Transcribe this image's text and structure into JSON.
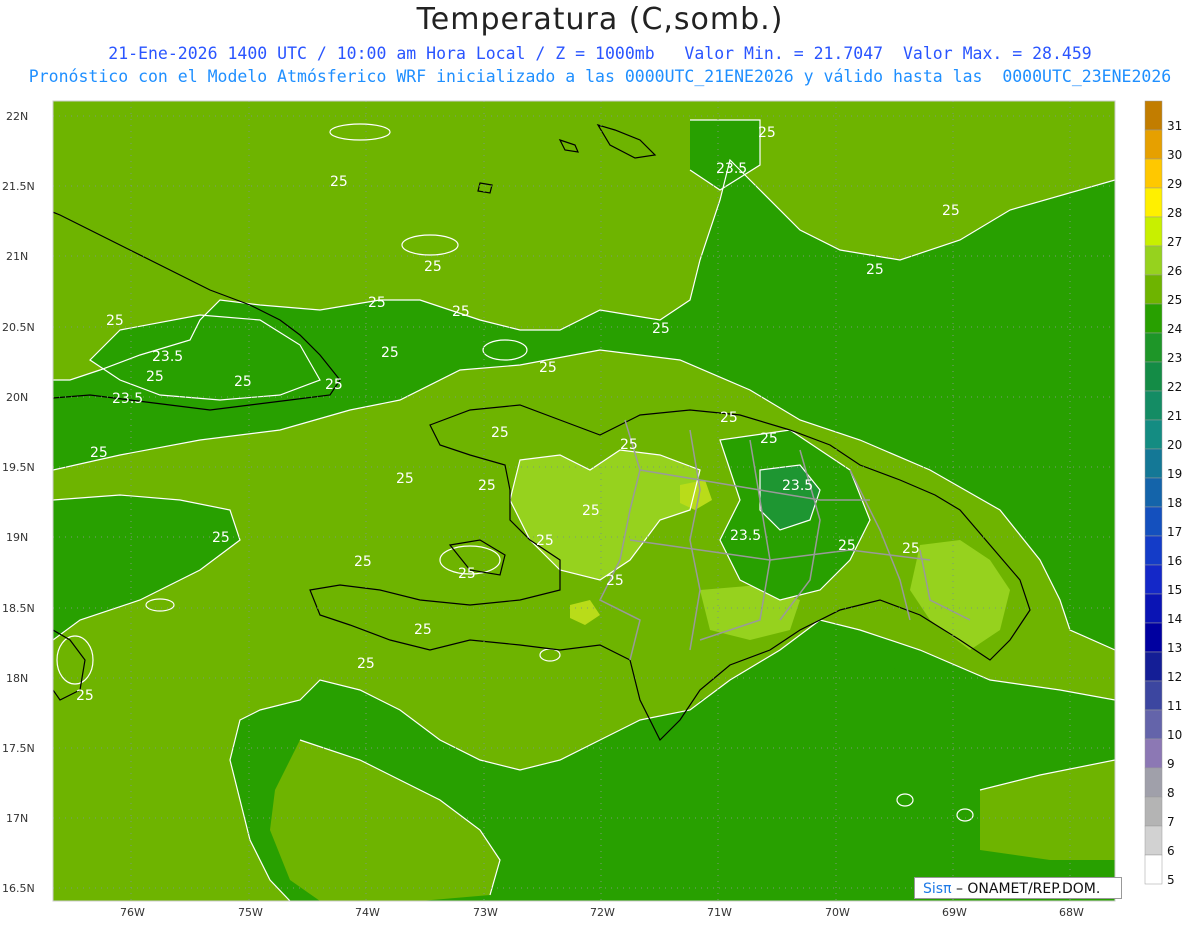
{
  "header": {
    "title": "Temperatura (C,somb.)",
    "line1": "21-Ene-2026 1400 UTC / 10:00 am Hora Local / Z = 1000mb   Valor Min. = 21.7047  Valor Max. = 28.459",
    "line2": "Pronóstico con el Modelo Atmósferico WRF inicializado a las 0000UTC_21ENE2026 y válido hasta las  0000UTC_23ENE2026"
  },
  "axes": {
    "lat_labels": [
      "22N",
      "21.5N",
      "21N",
      "20.5N",
      "20N",
      "19.5N",
      "19N",
      "18.5N",
      "18N",
      "17.5N",
      "17N",
      "16.5N"
    ],
    "lon_labels": [
      "76W",
      "75W",
      "74W",
      "73W",
      "72W",
      "71W",
      "70W",
      "69W",
      "68W"
    ]
  },
  "contour_labels": [
    "25",
    "25",
    "23.5",
    "25",
    "25",
    "25",
    "25",
    "25",
    "25",
    "23.5",
    "25",
    "23.5",
    "25",
    "25",
    "25",
    "25",
    "25",
    "25",
    "25",
    "25",
    "25",
    "25",
    "23.5",
    "25",
    "23.5",
    "25",
    "25",
    "25",
    "25",
    "25",
    "25",
    "25",
    "25",
    "25",
    "25",
    "25",
    "25"
  ],
  "colorbar": {
    "values": [
      "31",
      "30",
      "29",
      "28",
      "27",
      "26",
      "25",
      "24",
      "23",
      "22",
      "21",
      "20",
      "19",
      "18",
      "17",
      "16",
      "15",
      "14",
      "13",
      "12",
      "11",
      "10",
      "9",
      "8",
      "7",
      "6",
      "5"
    ],
    "colors": [
      "#c27d00",
      "#e6a000",
      "#ffc800",
      "#fff000",
      "#c8f000",
      "#96d21e",
      "#6eb400",
      "#28a000",
      "#1e9628",
      "#148c46",
      "#148c64",
      "#148c82",
      "#147896",
      "#1464aa",
      "#1450be",
      "#143cc8",
      "#1428c8",
      "#0a14b4",
      "#0000a0",
      "#141e96",
      "#3c46a0",
      "#6464aa",
      "#8c78b4",
      "#a0a0aa",
      "#b4b4b4",
      "#d2d2d2",
      "#ffffff"
    ]
  },
  "field_colors": {
    "t24": "#28a000",
    "t25": "#6eb400",
    "t26": "#96d21e",
    "t27": "#b9dc19",
    "t23": "#1e9632"
  },
  "credit": {
    "sis": "Sisπ",
    "text": " – ONAMET/REP.DOM."
  }
}
